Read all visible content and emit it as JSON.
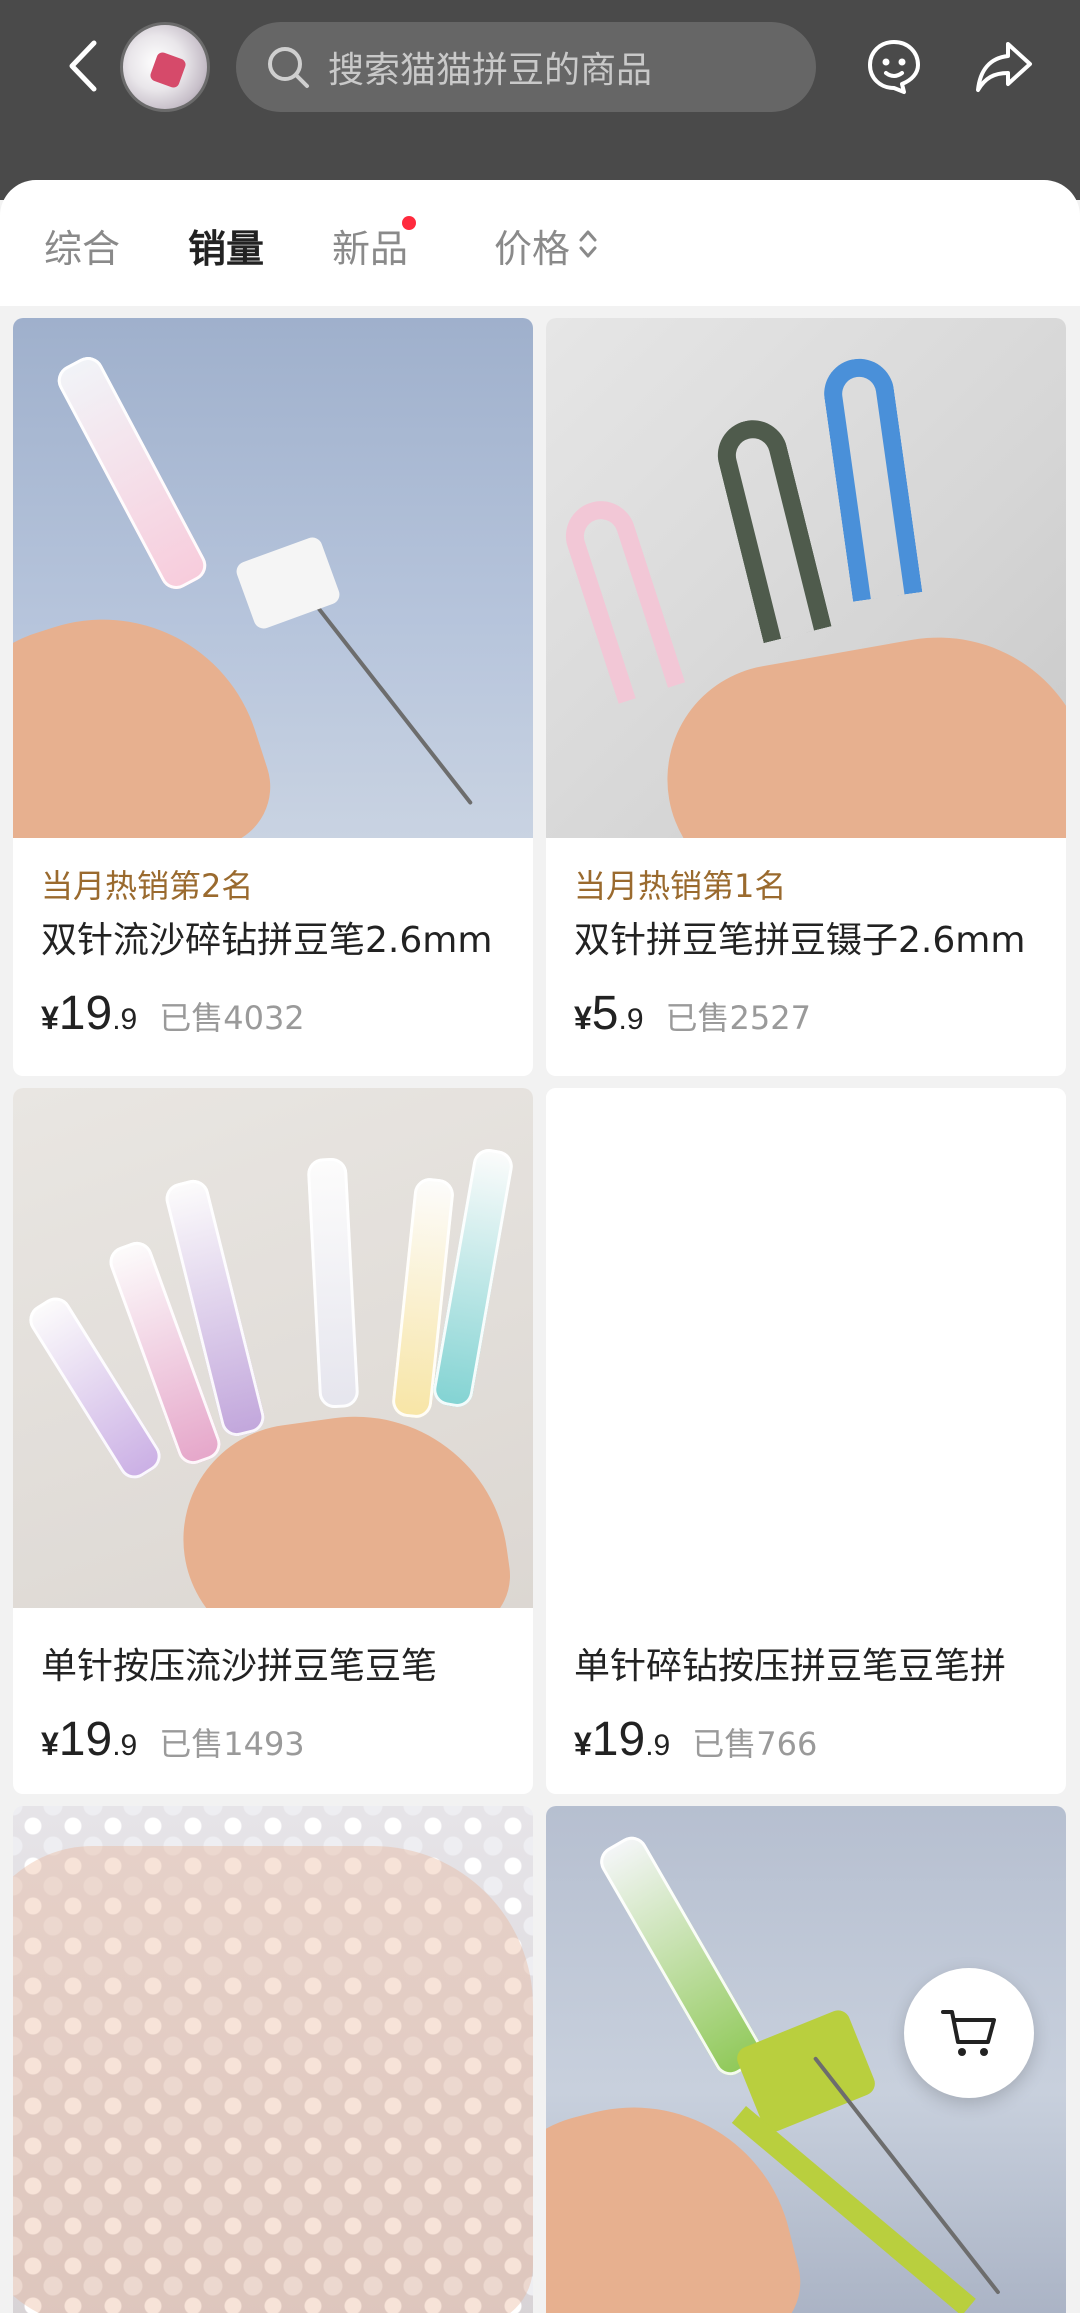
{
  "header": {
    "search_placeholder": "搜索猫猫拼豆的商品",
    "icons": {
      "back": "back-arrow-icon",
      "search": "search-icon",
      "chat": "customer-service-icon",
      "share": "share-icon"
    }
  },
  "sort_tabs": [
    {
      "label": "综合",
      "active": false
    },
    {
      "label": "销量",
      "active": true
    },
    {
      "label": "新品",
      "active": false,
      "has_dot": true
    },
    {
      "label": "价格",
      "active": false,
      "sortable": true
    }
  ],
  "products": [
    {
      "rank": "当月热销第2名",
      "title": "双针流沙碎钻拼豆笔2.6mm",
      "yen": "¥",
      "price_int": "19",
      "price_dec": ".9",
      "sold": "已售4032"
    },
    {
      "rank": "当月热销第1名",
      "title": "双针拼豆笔拼豆镊子2.6mm",
      "yen": "¥",
      "price_int": "5",
      "price_dec": ".9",
      "sold": "已售2527"
    },
    {
      "rank": "",
      "title": "单针按压流沙拼豆笔豆笔",
      "yen": "¥",
      "price_int": "19",
      "price_dec": ".9",
      "sold": "已售1493"
    },
    {
      "rank": "",
      "title": "单针碎钻按压拼豆笔豆笔拼",
      "yen": "¥",
      "price_int": "19",
      "price_dec": ".9",
      "sold": "已售766"
    }
  ],
  "floating": {
    "cart_icon": "cart-icon"
  },
  "colors": {
    "header_bg": "#4a4a4a",
    "accent_dot": "#ff2a3d",
    "rank_text": "#9a6a2e"
  }
}
